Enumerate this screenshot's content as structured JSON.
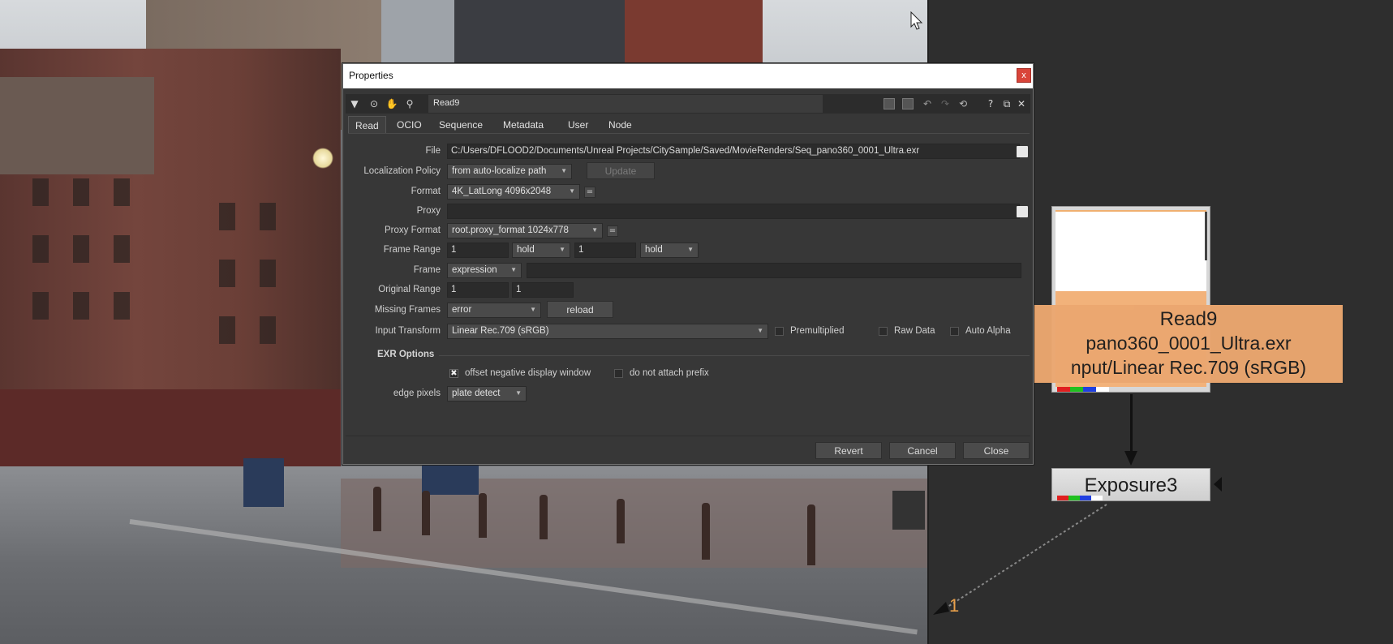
{
  "dialog": {
    "title": "Properties",
    "close_glyph": "x",
    "node_name": "Read9",
    "tabs": [
      "Read",
      "OCIO",
      "Sequence",
      "Metadata",
      "User",
      "Node"
    ],
    "active_tab": "Read",
    "fields": {
      "file_label": "File",
      "file_value": "C:/Users/DFLOOD2/Documents/Unreal Projects/CitySample/Saved/MovieRenders/Seq_pano360_0001_Ultra.exr",
      "localization_label": "Localization Policy",
      "localization_value": "from auto-localize path",
      "update_label": "Update",
      "format_label": "Format",
      "format_value": "4K_LatLong 4096x2048",
      "proxy_label": "Proxy",
      "proxy_value": "",
      "proxy_format_label": "Proxy Format",
      "proxy_format_value": "root.proxy_format 1024x778",
      "frame_range_label": "Frame Range",
      "frame_range_start": "1",
      "frame_range_before": "hold",
      "frame_range_end": "1",
      "frame_range_after": "hold",
      "frame_label": "Frame",
      "frame_mode": "expression",
      "frame_value": "",
      "original_range_label": "Original Range",
      "original_range_start": "1",
      "original_range_end": "1",
      "missing_frames_label": "Missing Frames",
      "missing_frames_value": "error",
      "reload_label": "reload",
      "input_transform_label": "Input Transform",
      "input_transform_value": "Linear Rec.709 (sRGB)",
      "premultiplied_label": "Premultiplied",
      "raw_data_label": "Raw Data",
      "auto_alpha_label": "Auto Alpha",
      "exr_options_label": "EXR Options",
      "offset_negative_label": "offset negative display window",
      "offset_negative_checked": true,
      "do_not_attach_prefix_label": "do not attach prefix",
      "edge_pixels_label": "edge pixels",
      "edge_pixels_value": "plate detect",
      "equals_glyph": "="
    },
    "buttons": {
      "revert": "Revert",
      "cancel": "Cancel",
      "close": "Close"
    },
    "toolbar_icons": [
      "collapse-arrow-icon",
      "center-icon",
      "hand-icon",
      "mask-icon",
      "display-toggle-icon",
      "invert-toggle-icon",
      "undo-icon",
      "redo-icon",
      "revert-icon",
      "help-icon",
      "float-icon",
      "close-panel-icon"
    ],
    "toolbar_glyphs": {
      "collapse": "▼",
      "center": "⊙",
      "hand": "✋",
      "mask": "⚲",
      "help": "?",
      "float": "⧉",
      "close": "✕"
    }
  },
  "node_graph": {
    "read_node": {
      "title": "Read9",
      "file": "pano360_0001_Ultra.exr",
      "colorspace": "nput/Linear Rec.709 (sRGB)"
    },
    "exposure_node": {
      "title": "Exposure3"
    },
    "input_number": "1",
    "colors": {
      "read_node_label": "#eba770",
      "input_number": "#e9a04a",
      "graph_background": "#2e2e2e",
      "dialog_background": "#373737"
    }
  }
}
